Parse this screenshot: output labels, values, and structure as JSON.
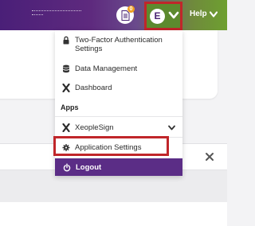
{
  "header": {
    "notification_count": "0",
    "user_initial": "E",
    "help_label": "Help"
  },
  "menu": {
    "items": [
      {
        "label": "Two-Factor Authentication Settings",
        "icon": "lock-icon"
      },
      {
        "label": "Data Management",
        "icon": "database-icon"
      },
      {
        "label": "Dashboard",
        "icon": "x-logo-icon"
      }
    ],
    "apps_heading": "Apps",
    "apps": [
      {
        "label": "XeopleSign",
        "icon": "x-logo-icon"
      },
      {
        "label": "Application Settings",
        "icon": "gear-icon"
      }
    ],
    "logout_label": "Logout"
  },
  "colors": {
    "brand_purple": "#5b2d86",
    "highlight_red": "#c0262a",
    "header_green": "#6ea030"
  }
}
